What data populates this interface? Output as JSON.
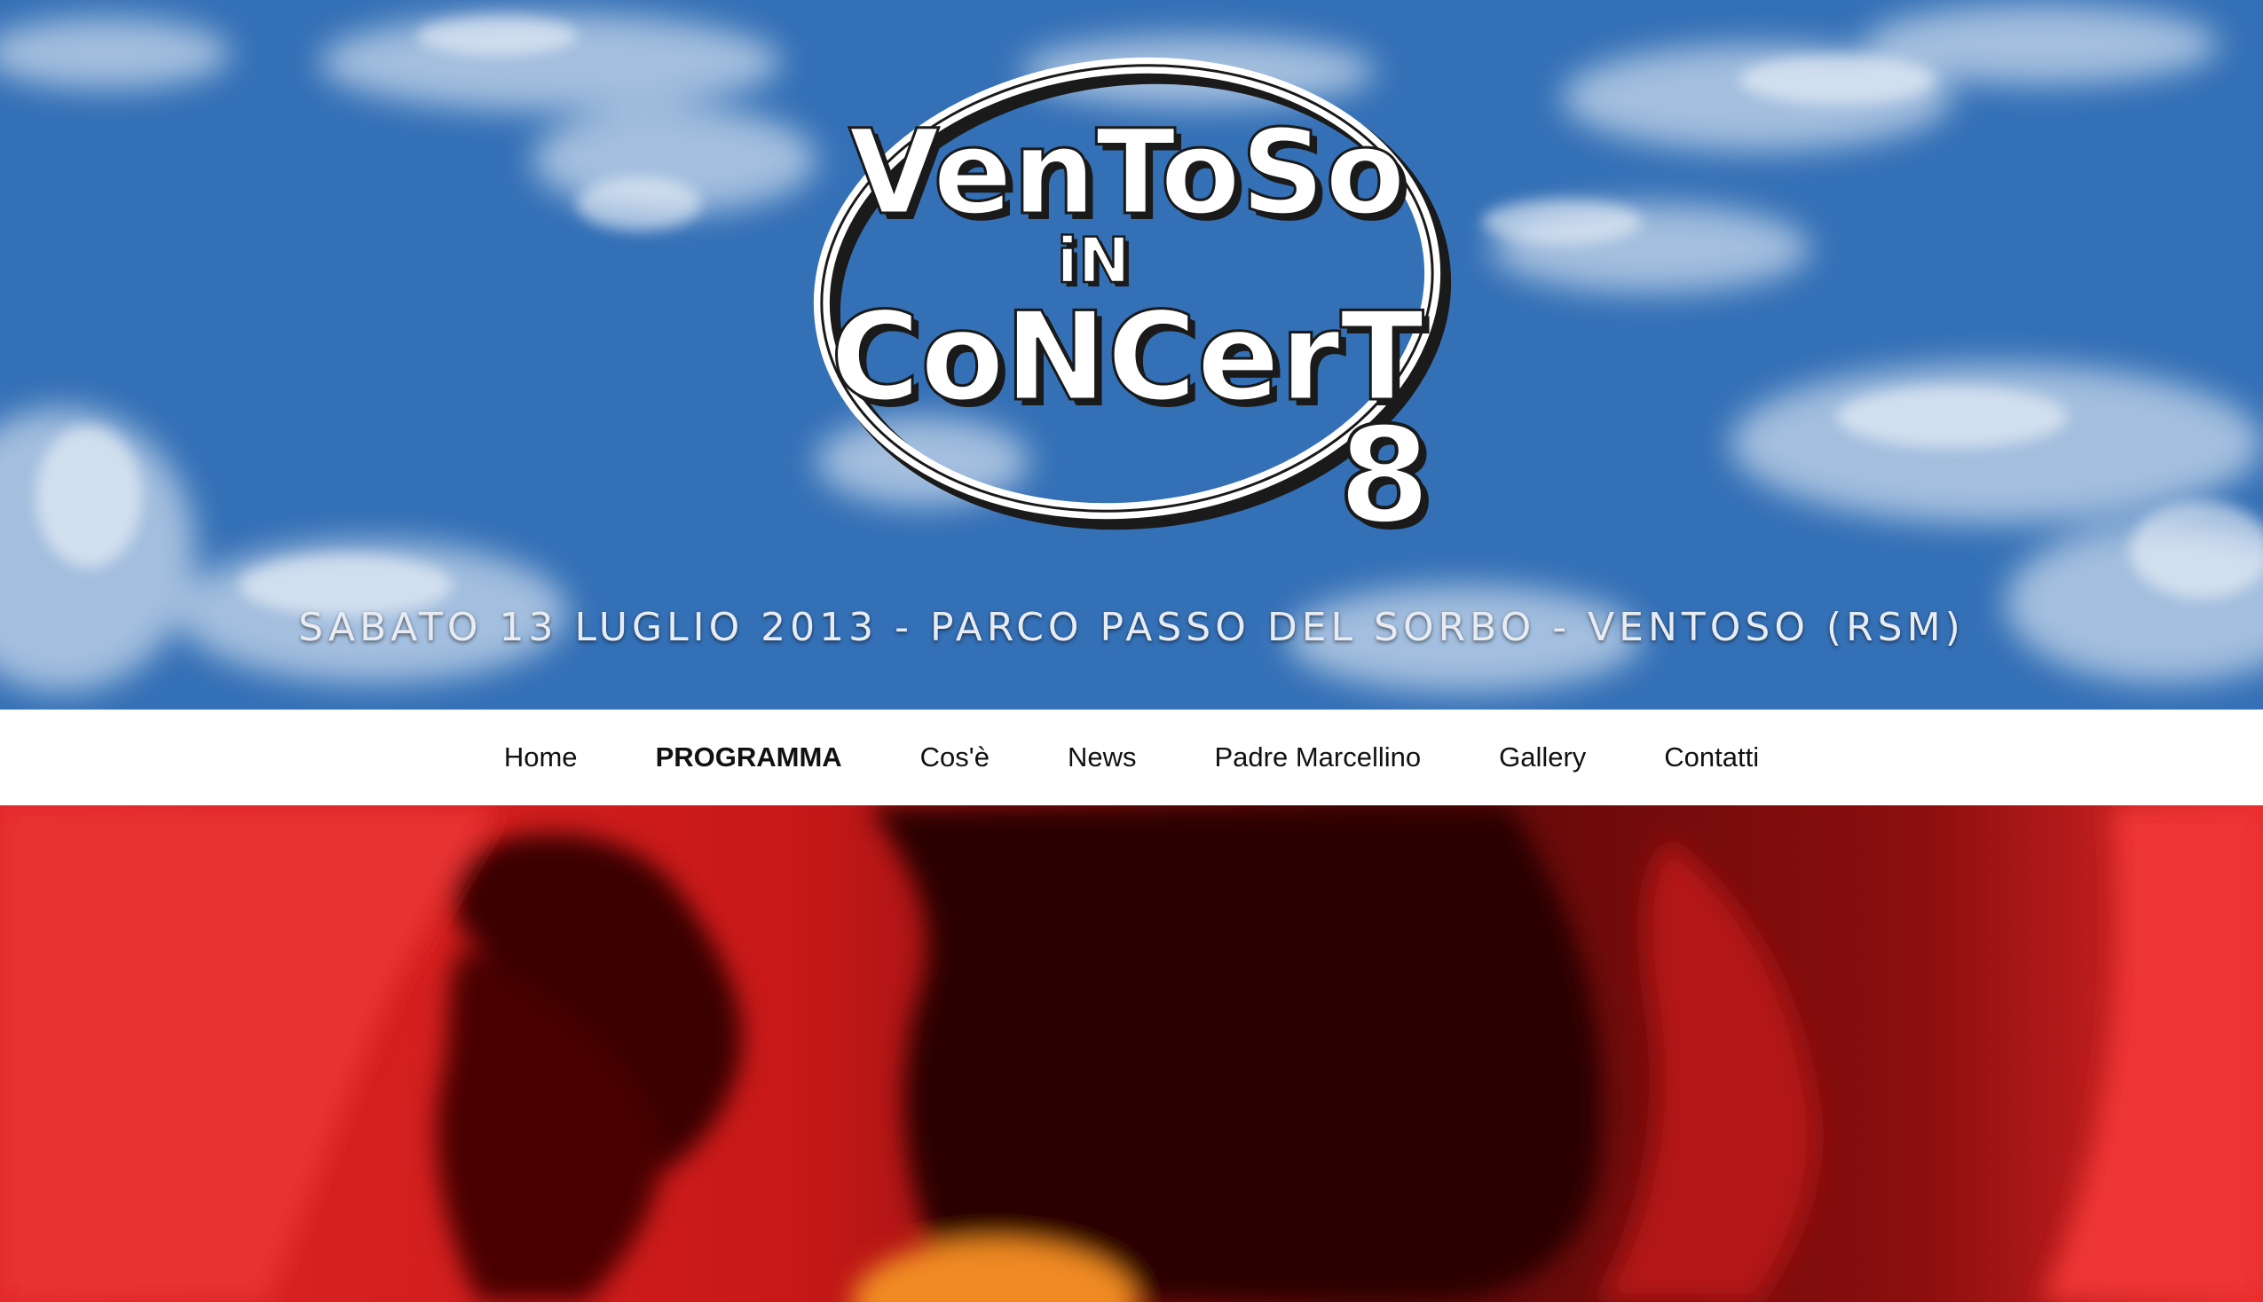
{
  "hero": {
    "event_line": "SABATO 13 LUGLIO 2013 - PARCO PASSO DEL SORBO - VENTOSO (RSM)",
    "logo": {
      "line1": "VenToSo",
      "line2": "iN",
      "line3": "CoNCerT",
      "edition": "8"
    }
  },
  "nav": {
    "items": [
      {
        "label": "Home",
        "active": false
      },
      {
        "label": "PROGRAMMA",
        "active": true
      },
      {
        "label": "Cos'è",
        "active": false
      },
      {
        "label": "News",
        "active": false
      },
      {
        "label": "Padre Marcellino",
        "active": false
      },
      {
        "label": "Gallery",
        "active": false
      },
      {
        "label": "Contatti",
        "active": false
      }
    ]
  },
  "colors": {
    "sky": "#3a74b9",
    "nav_background": "#ffffff",
    "nav_text": "#111111",
    "photo_red": "#d61a1a"
  }
}
